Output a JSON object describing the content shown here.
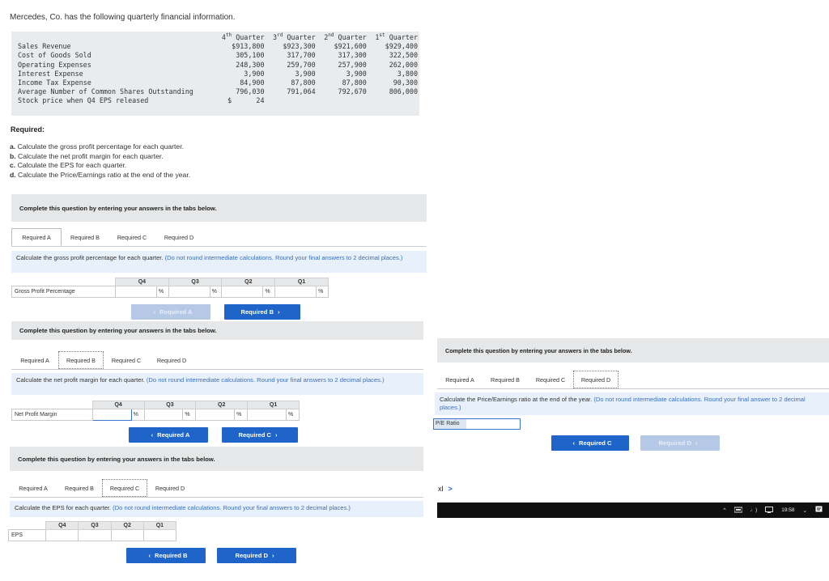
{
  "intro": "Mercedes, Co. has the following quarterly financial information.",
  "financials": {
    "header": [
      {
        "ord": "4",
        "sup": "th",
        "word": "Quarter"
      },
      {
        "ord": "3",
        "sup": "rd",
        "word": "Quarter"
      },
      {
        "ord": "2",
        "sup": "nd",
        "word": "Quarter"
      },
      {
        "ord": "1",
        "sup": "st",
        "word": "Quarter"
      }
    ],
    "rows": [
      {
        "label": "Sales Revenue",
        "values": [
          "$913,800",
          "$923,300",
          "$921,600",
          "$929,400"
        ]
      },
      {
        "label": "Cost of Goods Sold",
        "values": [
          "305,100",
          "317,700",
          "317,300",
          "322,500"
        ]
      },
      {
        "label": "Operating Expenses",
        "values": [
          "248,300",
          "259,700",
          "257,900",
          "262,000"
        ]
      },
      {
        "label": "Interest Expense",
        "values": [
          "3,900",
          "3,900",
          "3,900",
          "3,800"
        ]
      },
      {
        "label": "Income Tax Expense",
        "values": [
          "84,900",
          "87,800",
          "87,800",
          "90,300"
        ]
      },
      {
        "label": "Average Number of Common Shares Outstanding",
        "values": [
          "796,030",
          "791,064",
          "792,670",
          "806,000"
        ]
      },
      {
        "label": "Stock price when Q4 EPS released",
        "values": [
          "$      24",
          "",
          "",
          ""
        ]
      }
    ]
  },
  "required": {
    "title": "Required:",
    "items": [
      {
        "letter": "a.",
        "text": "Calculate the gross profit percentage for each quarter."
      },
      {
        "letter": "b.",
        "text": "Calculate the net profit margin for each quarter."
      },
      {
        "letter": "c.",
        "text": "Calculate the EPS for each quarter."
      },
      {
        "letter": "d.",
        "text": "Calculate the Price/Earnings ratio at the end of the year."
      }
    ]
  },
  "common": {
    "banner": "Complete this question by entering your answers in the tabs below.",
    "tabs": [
      "Required A",
      "Required B",
      "Required C",
      "Required D"
    ],
    "quarters": [
      "Q4",
      "Q3",
      "Q2",
      "Q1"
    ],
    "pct": "%"
  },
  "panelA": {
    "instruction": "Calculate the gross profit percentage for each quarter.",
    "hint": "(Do not round intermediate calculations. Round your final answers to 2 decimal places.)",
    "row_label": "Gross Profit Percentage",
    "prev": "Required A",
    "next": "Required B"
  },
  "panelB": {
    "instruction": "Calculate the net profit margin for each quarter.",
    "hint": "(Do not round intermediate calculations. Round your final answers to 2 decimal places.)",
    "row_label": "Net Profit Margin",
    "prev": "Required A",
    "next": "Required C"
  },
  "panelC": {
    "instruction": "Calculate the EPS for each quarter.",
    "hint": "(Do not round intermediate calculations. Round your final answers to 2 decimal places.)",
    "row_label": "EPS",
    "prev": "Required B",
    "next": "Required D"
  },
  "panelD": {
    "instruction": "Calculate the Price/Earnings ratio at the end of the year.",
    "hint": "(Do not round intermediate calculations. Round your final answer to 2 decimal places.)",
    "row_label": "P/E Ratio",
    "prev": "Required C",
    "next": "Required D"
  },
  "excel": {
    "label": "xl",
    "arrow": ">"
  },
  "taskbar": {
    "time": "19:58",
    "icons": [
      "^",
      "wifi-icon",
      "speaker-icon",
      "battery-icon"
    ]
  }
}
